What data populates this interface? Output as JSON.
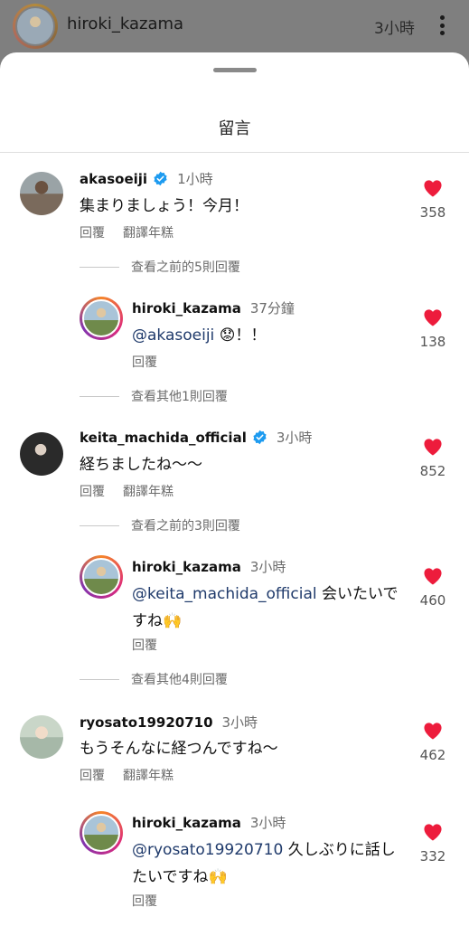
{
  "post_header": {
    "username": "hiroki_kazama",
    "time": "3小時"
  },
  "sheet": {
    "title": "留言"
  },
  "comments": [
    {
      "username": "akasoeiji",
      "verified": true,
      "time": "1小時",
      "text": "集まりましょう！今月！",
      "reply_label": "回覆",
      "translate_label": "翻譯年糕",
      "likes": "358",
      "toggle": "查看之前的5則回覆"
    },
    {
      "username": "hiroki_kazama",
      "time": "37分鐘",
      "mention": "@akasoeiji",
      "text_after": "😟！！",
      "reply_label": "回覆",
      "likes": "138",
      "toggle": "查看其他1則回覆"
    },
    {
      "username": "keita_machida_official",
      "verified": true,
      "time": "3小時",
      "text": "経ちましたね〜〜",
      "reply_label": "回覆",
      "translate_label": "翻譯年糕",
      "likes": "852",
      "toggle": "查看之前的3則回覆"
    },
    {
      "username": "hiroki_kazama",
      "time": "3小時",
      "mention": "@keita_machida_official",
      "text_after": " 会いたいで",
      "text_line2": "すね🙌",
      "reply_label": "回覆",
      "likes": "460",
      "toggle": "查看其他4則回覆"
    },
    {
      "username": "ryosato19920710",
      "time": "3小時",
      "text": "もうそんなに経つんですね〜",
      "reply_label": "回覆",
      "translate_label": "翻譯年糕",
      "likes": "462"
    },
    {
      "username": "hiroki_kazama",
      "time": "3小時",
      "mention": "@ryosato19920710",
      "text_after": " 久しぶりに話し",
      "text_line2": "たいですね🙌",
      "reply_label": "回覆",
      "likes": "332"
    }
  ],
  "colors": {
    "like": "#ed1c3c",
    "verified": "#1d9bf0",
    "mention": "#1f3a6b"
  },
  "icons": {
    "more": "more-vertical-icon",
    "heart": "heart-filled-icon",
    "verified": "verified-badge-icon"
  }
}
